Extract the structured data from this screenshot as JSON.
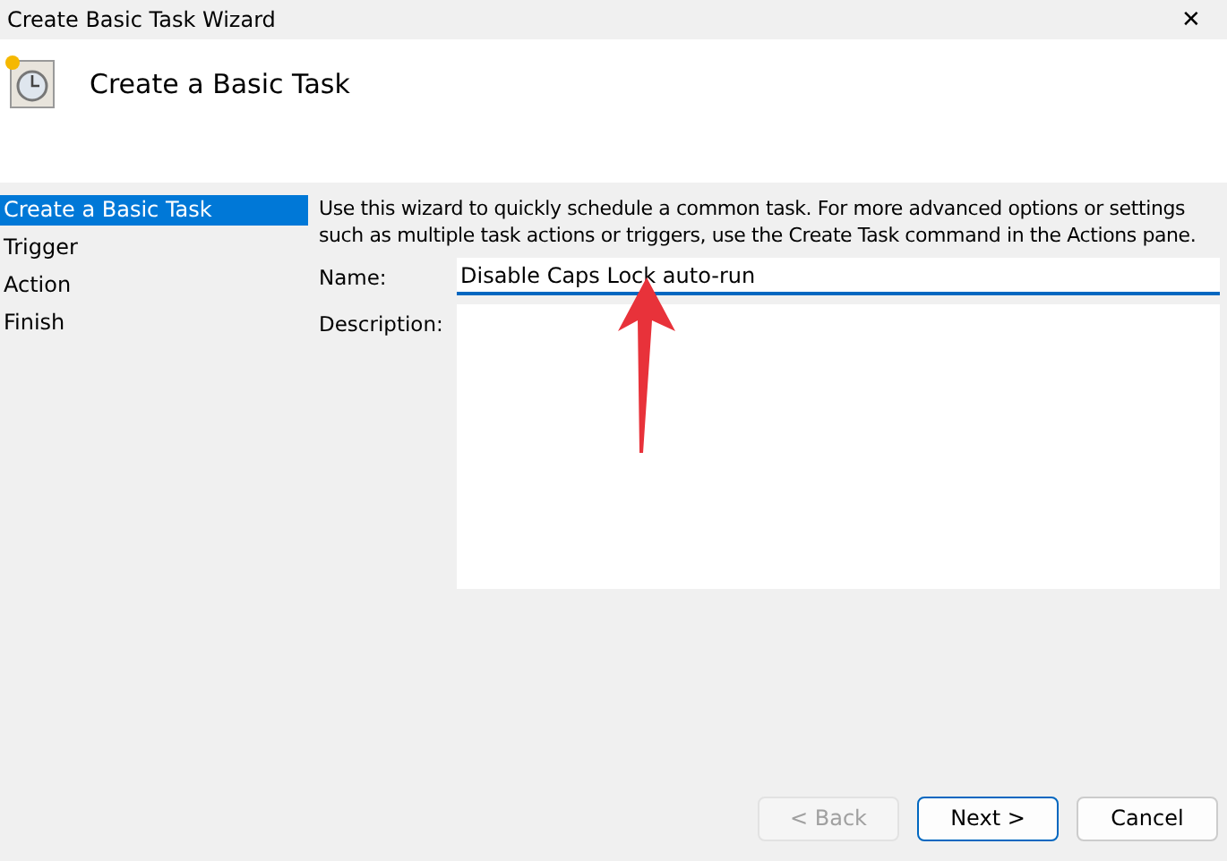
{
  "window": {
    "title": "Create Basic Task Wizard",
    "close": "✕"
  },
  "header": {
    "title": "Create a Basic Task"
  },
  "steps": [
    {
      "label": "Create a Basic Task",
      "selected": true
    },
    {
      "label": "Trigger",
      "selected": false
    },
    {
      "label": "Action",
      "selected": false
    },
    {
      "label": "Finish",
      "selected": false
    }
  ],
  "intro": "Use this wizard to quickly schedule a common task.  For more advanced options or settings such as multiple task actions or triggers, use the Create Task command in the Actions pane.",
  "name_field": {
    "label": "Name:",
    "value": "Disable Caps Lock auto-run"
  },
  "description_field": {
    "label": "Description:"
  },
  "buttons": [
    {
      "label": "< Back",
      "disabled": true,
      "default": false
    },
    {
      "label": "Next >",
      "disabled": false,
      "default": true
    },
    {
      "label": "Cancel",
      "disabled": false,
      "default": false
    }
  ]
}
